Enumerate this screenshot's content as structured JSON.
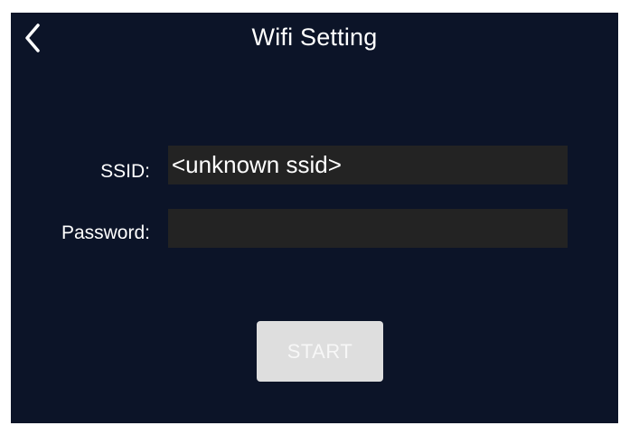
{
  "header": {
    "title": "Wifi Setting",
    "back_icon": "chevron-left-icon"
  },
  "form": {
    "ssid_label": "SSID:",
    "ssid_value": "<unknown ssid>",
    "password_label": "Password:",
    "password_value": ""
  },
  "actions": {
    "start_label": "START"
  },
  "colors": {
    "background": "#0c1428",
    "field_background": "#232323",
    "button_background": "#dedede",
    "text": "#ffffff"
  }
}
